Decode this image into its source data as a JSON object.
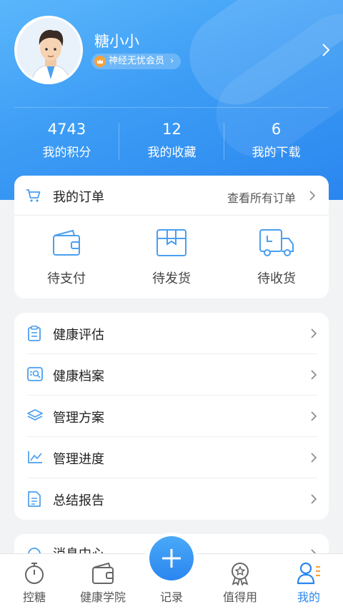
{
  "profile": {
    "name": "糖小小",
    "member_label": "神经无忧会员",
    "member_chevron": "›"
  },
  "stats": [
    {
      "value": "4743",
      "label": "我的积分"
    },
    {
      "value": "12",
      "label": "我的收藏"
    },
    {
      "value": "6",
      "label": "我的下载"
    }
  ],
  "orders": {
    "title": "我的订单",
    "view_all": "查看所有订单",
    "items": [
      {
        "label": "待支付",
        "icon": "wallet-icon"
      },
      {
        "label": "待发货",
        "icon": "package-icon"
      },
      {
        "label": "待收货",
        "icon": "truck-icon"
      }
    ]
  },
  "menu": [
    {
      "label": "健康评估",
      "icon": "clipboard-icon"
    },
    {
      "label": "健康档案",
      "icon": "profile-card-icon"
    },
    {
      "label": "管理方案",
      "icon": "layers-icon"
    },
    {
      "label": "管理进度",
      "icon": "line-chart-icon"
    },
    {
      "label": "总结报告",
      "icon": "document-icon"
    }
  ],
  "partial_row": {
    "label": "消息中心",
    "icon": "message-icon"
  },
  "tabbar": [
    {
      "label": "控糖",
      "icon": "stopwatch-icon"
    },
    {
      "label": "健康学院",
      "icon": "wallet-tab-icon"
    },
    {
      "label": "记录",
      "icon": "plus-icon"
    },
    {
      "label": "值得用",
      "icon": "award-icon"
    },
    {
      "label": "我的",
      "icon": "person-icon",
      "active": true
    }
  ],
  "colors": {
    "accent": "#2a86ef",
    "badge": "#f7a23b",
    "icon_blue": "#4a9ff0"
  }
}
